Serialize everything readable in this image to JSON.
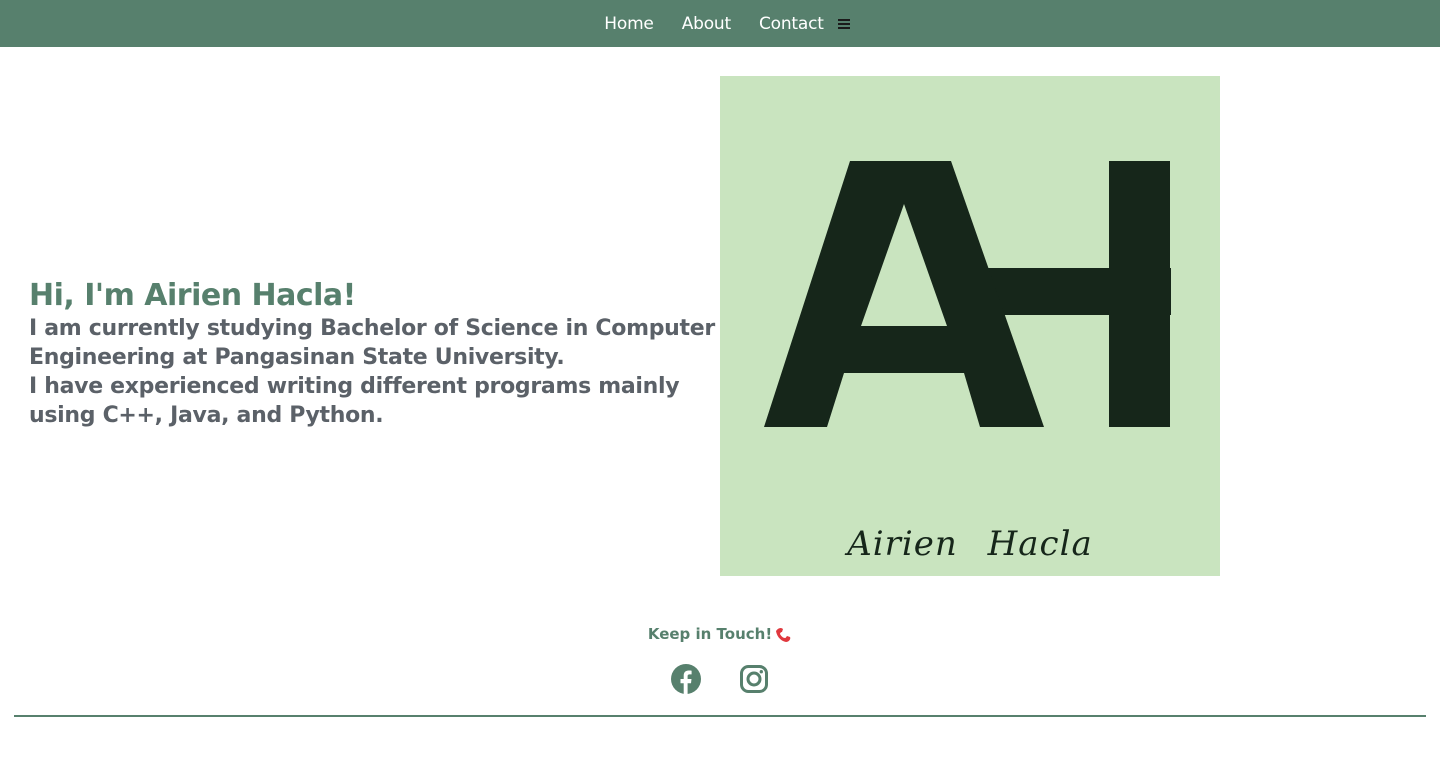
{
  "nav": {
    "items": [
      {
        "label": "Home"
      },
      {
        "label": "About"
      },
      {
        "label": "Contact"
      }
    ],
    "menu_icon": "hamburger-menu-icon"
  },
  "intro": {
    "greeting": "Hi, I'm Airien Hacla!",
    "line1": "I am currently studying Bachelor of Science in Computer Engineering at Pangasinan State University.",
    "line2": "I have experienced writing different programs mainly using C++, Java, and Python."
  },
  "logo": {
    "monogram": "AH",
    "signature": "Airien Hacla",
    "background_color": "#c9e4bf",
    "letter_color": "#16261a"
  },
  "contact": {
    "heading": "Keep in Touch!",
    "heading_icon": "phone-icon",
    "socials": [
      {
        "icon": "facebook-icon"
      },
      {
        "icon": "instagram-icon"
      }
    ]
  },
  "colors": {
    "brand": "#57806d",
    "text": "#5b6168"
  }
}
